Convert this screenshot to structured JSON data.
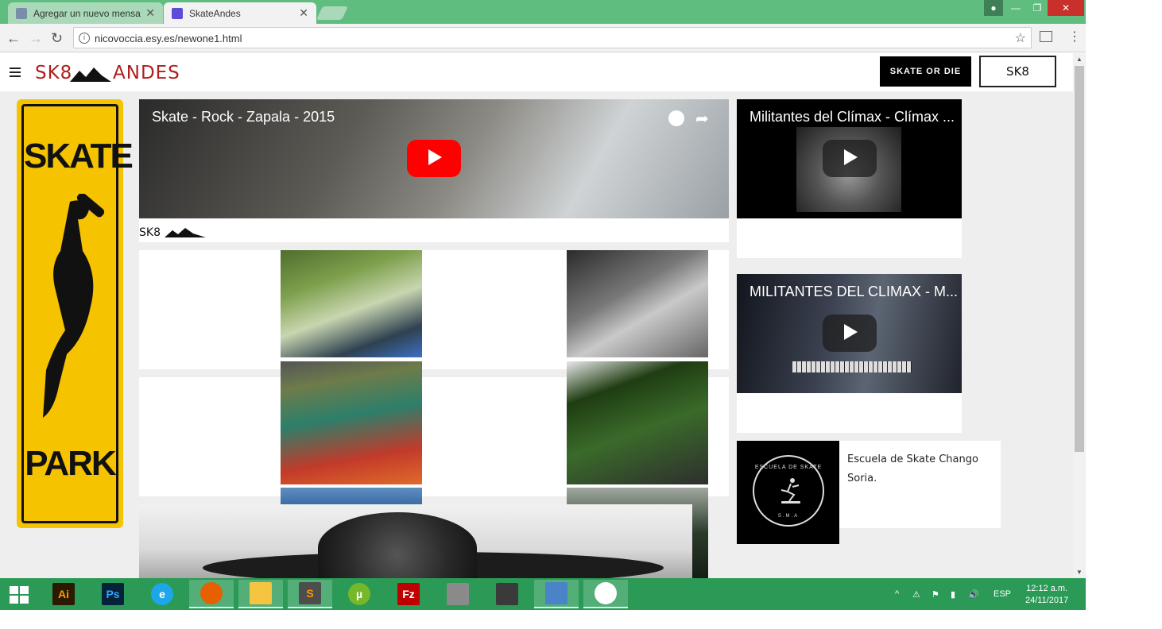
{
  "browser": {
    "tabs": [
      {
        "title": "Agregar un nuevo mensa",
        "close": "✕"
      },
      {
        "title": "SkateAndes",
        "close": "✕"
      }
    ],
    "url": "nicovoccia.esy.es/newone1.html",
    "controls": {
      "back": "←",
      "forward": "→",
      "reload": "↻",
      "star": "☆",
      "menu": "⋮",
      "min": "—",
      "max": "❐",
      "close": "✕",
      "info": "i"
    }
  },
  "site": {
    "logo_left": "SK8",
    "logo_right": "ANDES",
    "nav_button_image": "SKATE OR DIE",
    "nav_button": "SK8",
    "sign_word1": "SKATE",
    "sign_word2": "PARK",
    "video_main": {
      "title": "Skate - Rock - Zapala - 2015"
    },
    "caption_band": "SK8",
    "video_2": {
      "title": "Militantes del Clímax - Clímax ..."
    },
    "video_3": {
      "title": "MILITANTES DEL CLIMAX - M..."
    },
    "escuela": {
      "text": "Escuela de Skate Chango Soria.",
      "logo_arc": "ESCUELA DE SKATE",
      "logo_bottom": "S.M.A"
    }
  },
  "taskbar": {
    "apps": [
      {
        "label": "Ai",
        "icon": "illustrator-icon",
        "color": "#2b1a00",
        "fg": "#ff9a00"
      },
      {
        "label": "Ps",
        "icon": "photoshop-icon",
        "color": "#06213a",
        "fg": "#31a8ff"
      },
      {
        "label": "e",
        "icon": "internet-explorer-icon",
        "color": "#1ea7e8",
        "fg": "#ffffff"
      },
      {
        "label": "",
        "icon": "firefox-icon",
        "color": "#e66000",
        "fg": "#ffffff"
      },
      {
        "label": "",
        "icon": "file-explorer-icon",
        "color": "#f5c542",
        "fg": "#ffffff"
      },
      {
        "label": "S",
        "icon": "sublime-text-icon",
        "color": "#4d4d4d",
        "fg": "#ff9800"
      },
      {
        "label": "µ",
        "icon": "utorrent-icon",
        "color": "#76b82a",
        "fg": "#ffffff"
      },
      {
        "label": "Fz",
        "icon": "filezilla-icon",
        "color": "#bf0000",
        "fg": "#ffffff"
      },
      {
        "label": "",
        "icon": "server-app-icon",
        "color": "#8a8a8a",
        "fg": "#ffffff"
      },
      {
        "label": "",
        "icon": "wizard-app-icon",
        "color": "#3a3a3a",
        "fg": "#ffffff"
      },
      {
        "label": "",
        "icon": "control-panel-icon",
        "color": "#4b83c9",
        "fg": "#ffffff"
      },
      {
        "label": "",
        "icon": "chrome-icon",
        "color": "#ffffff",
        "fg": "#db4437"
      }
    ],
    "lang": "ESP",
    "time": "12:12 a.m.",
    "date": "24/11/2017"
  }
}
